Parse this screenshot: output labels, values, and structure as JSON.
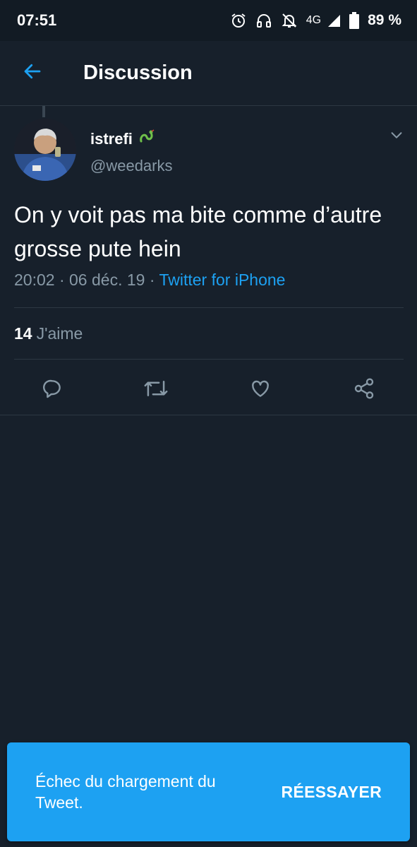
{
  "status_bar": {
    "time": "07:51",
    "network": "4G",
    "battery": "89 %",
    "icons": [
      "alarm-icon",
      "headphones-icon",
      "notifications-off-icon",
      "signal-icon",
      "battery-icon"
    ]
  },
  "app_bar": {
    "back_icon": "arrow-left-icon",
    "title": "Discussion"
  },
  "tweet": {
    "author_name": "istrefi",
    "author_emoji": "snake-icon",
    "author_handle": "@weedarks",
    "text": "On y voit pas ma bite comme d’autre grosse pute hein",
    "time": "20:02",
    "date": "06 déc. 19",
    "separator": "·",
    "source": "Twitter for iPhone",
    "likes_count": "14",
    "likes_label": "J'aime",
    "actions": [
      "reply-icon",
      "retweet-icon",
      "like-icon",
      "share-icon"
    ]
  },
  "toast": {
    "message": "Échec du chargement du Tweet.",
    "action": "RÉESSAYER"
  },
  "colors": {
    "background": "#17202b",
    "accent": "#1da1f2",
    "secondary_text": "#8899a6",
    "divider": "#2d3843"
  }
}
